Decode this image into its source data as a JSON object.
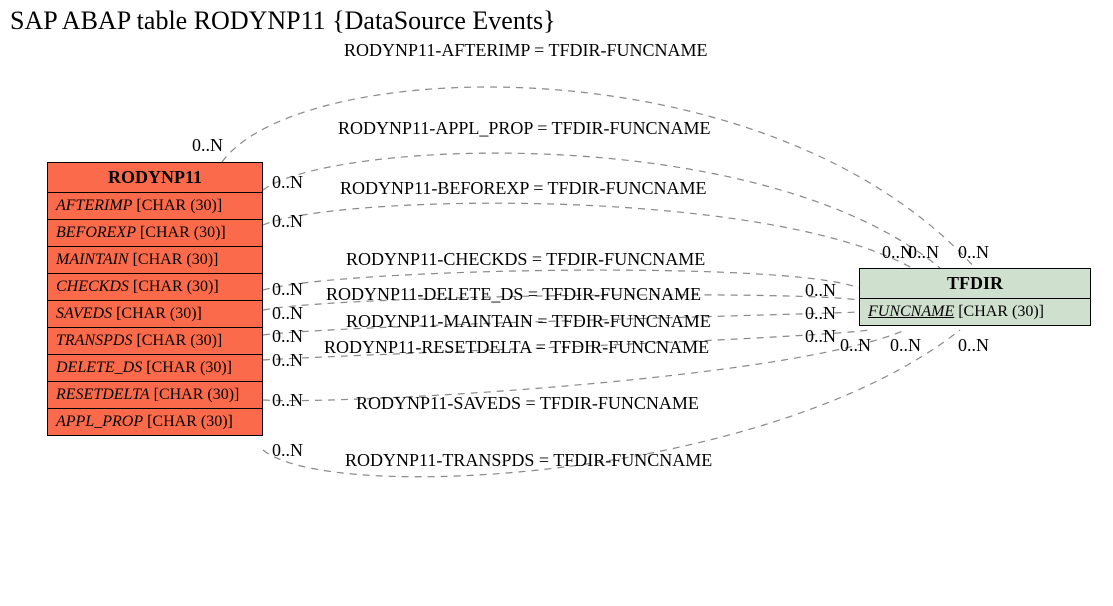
{
  "title": "SAP ABAP table RODYNP11 {DataSource Events}",
  "entities": {
    "rodynp11": {
      "name": "RODYNP11",
      "rows": [
        {
          "attr": "AFTERIMP",
          "type": "[CHAR (30)]"
        },
        {
          "attr": "BEFOREXP",
          "type": "[CHAR (30)]"
        },
        {
          "attr": "MAINTAIN",
          "type": "[CHAR (30)]"
        },
        {
          "attr": "CHECKDS",
          "type": "[CHAR (30)]"
        },
        {
          "attr": "SAVEDS",
          "type": "[CHAR (30)]"
        },
        {
          "attr": "TRANSPDS",
          "type": "[CHAR (30)]"
        },
        {
          "attr": "DELETE_DS",
          "type": "[CHAR (30)]"
        },
        {
          "attr": "RESETDELTA",
          "type": "[CHAR (30)]"
        },
        {
          "attr": "APPL_PROP",
          "type": "[CHAR (30)]"
        }
      ]
    },
    "tfdir": {
      "name": "TFDIR",
      "rows": [
        {
          "attr": "FUNCNAME",
          "type": "[CHAR (30)]"
        }
      ]
    }
  },
  "relations": [
    {
      "text": "RODYNP11-AFTERIMP = TFDIR-FUNCNAME"
    },
    {
      "text": "RODYNP11-APPL_PROP = TFDIR-FUNCNAME"
    },
    {
      "text": "RODYNP11-BEFOREXP = TFDIR-FUNCNAME"
    },
    {
      "text": "RODYNP11-CHECKDS = TFDIR-FUNCNAME"
    },
    {
      "text": "RODYNP11-DELETE_DS = TFDIR-FUNCNAME"
    },
    {
      "text": "RODYNP11-MAINTAIN = TFDIR-FUNCNAME"
    },
    {
      "text": "RODYNP11-RESETDELTA = TFDIR-FUNCNAME"
    },
    {
      "text": "RODYNP11-SAVEDS = TFDIR-FUNCNAME"
    },
    {
      "text": "RODYNP11-TRANSPDS = TFDIR-FUNCNAME"
    }
  ],
  "cardinalities": {
    "left_top": "0..N",
    "l1": "0..N",
    "l2": "0..N",
    "l3": "0..N",
    "l4": "0..N",
    "l5": "0..N",
    "l6": "0..N",
    "l7": "0..N",
    "l8": "0..N",
    "r1": "0..N",
    "r2": "0..N",
    "r3": "0..N",
    "rt1": "0..N",
    "rt2": "0..N",
    "rt3": "0..N",
    "rb1": "0..N",
    "rb2": "0..N",
    "rb3": "0..N"
  }
}
